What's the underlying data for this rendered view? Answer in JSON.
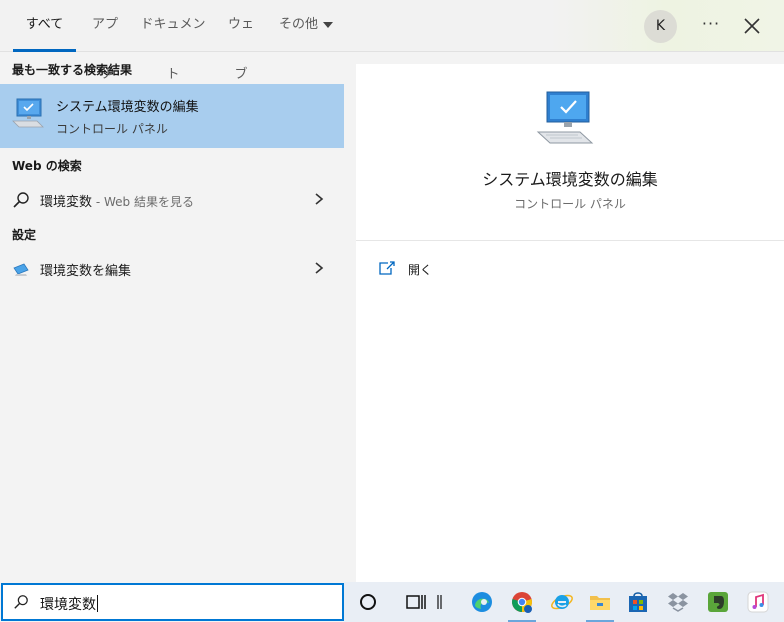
{
  "tabs": [
    {
      "label": "すべて"
    },
    {
      "label": "アプリ"
    },
    {
      "label": "ドキュメント"
    },
    {
      "label": "ウェブ"
    },
    {
      "label": "その他"
    }
  ],
  "user": {
    "initial": "K"
  },
  "topbar": {
    "more_label": "···"
  },
  "left": {
    "best_match_heading": "最も一致する検索結果",
    "best_match": {
      "title": "システム環境変数の編集",
      "subtitle": "コントロール パネル",
      "icon": "computer-icon"
    },
    "web_heading": "Web の検索",
    "web_result": {
      "query": "環境変数",
      "suffix": " - Web 結果を見る",
      "icon": "search-icon"
    },
    "settings_heading": "設定",
    "settings_result": {
      "bold": "環境変数",
      "rest": "を編集",
      "icon": "settings-monitor-icon"
    }
  },
  "right": {
    "title": "システム環境変数の編集",
    "subtitle": "コントロール パネル",
    "open_label": "開く",
    "icon": "computer-icon"
  },
  "search": {
    "value": "環境変数"
  },
  "taskbar": {
    "icons": [
      "cortana-circle-icon",
      "task-view-icon",
      "separator-icon",
      "edge-icon",
      "chrome-icon",
      "internet-explorer-icon",
      "file-explorer-icon",
      "microsoft-store-icon",
      "dropbox-icon",
      "evernote-icon",
      "itunes-icon"
    ]
  },
  "colors": {
    "accent": "#0067c0",
    "highlight": "#a8cdee",
    "search_border": "#0078d4"
  }
}
